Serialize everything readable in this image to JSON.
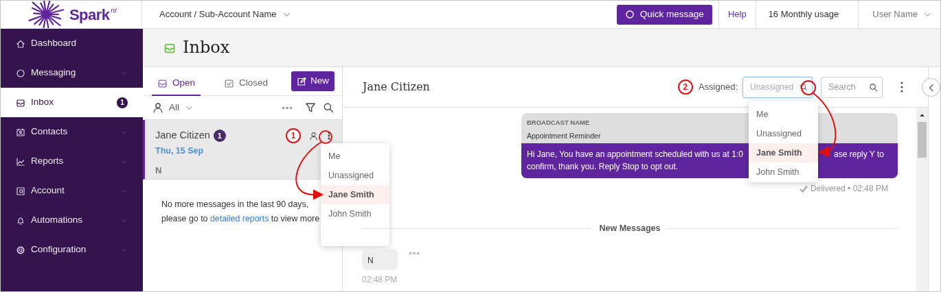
{
  "header": {
    "logo": "Spark$^{nz}$",
    "account": "Account / Sub-Account Name",
    "quick_message": "Quick message",
    "help": "Help",
    "usage": "16 Monthly usage",
    "user": "User Name"
  },
  "sidebar": {
    "items": [
      {
        "label": "Dashboard",
        "has_submenu": false,
        "selected": false
      },
      {
        "label": "Messaging",
        "has_submenu": true,
        "selected": false
      },
      {
        "label": "Inbox",
        "has_submenu": false,
        "selected": true,
        "badge": "1"
      },
      {
        "label": "Contacts",
        "has_submenu": true,
        "selected": false
      },
      {
        "label": "Reports",
        "has_submenu": true,
        "selected": false
      },
      {
        "label": "Account",
        "has_submenu": true,
        "selected": false
      },
      {
        "label": "Automations",
        "has_submenu": true,
        "selected": false
      },
      {
        "label": "Configuration",
        "has_submenu": true,
        "selected": false
      }
    ]
  },
  "page_title": "Inbox",
  "conversation_list": {
    "tabs": [
      {
        "label": "Open",
        "selected": true
      },
      {
        "label": "Closed",
        "selected": false
      }
    ],
    "new_button": "New",
    "filter": "All",
    "items": [
      {
        "name": "Jane Citizen",
        "badge": "1",
        "date": "Thu, 15 Sep",
        "preview": "N",
        "selected": true,
        "marker": "1"
      }
    ],
    "end_note": {
      "line_1": "No more messages in the last 90 days,",
      "before_link": "please go to",
      "link": "detailed reports",
      "after_link": "to view more"
    },
    "assign_menu": {
      "options": [
        {
          "label": "Me",
          "selected": false
        },
        {
          "label": "Unassigned",
          "selected": false
        },
        {
          "label": "Jane Smith",
          "selected": true
        },
        {
          "label": "John Smith",
          "selected": false
        }
      ]
    }
  },
  "conversation": {
    "title": "Jane Citizen",
    "marker": "2",
    "assigned": {
      "label": "Assigned:",
      "placeholder": "Unassigned",
      "focused": true,
      "options": [
        {
          "label": "Me",
          "selected": false
        },
        {
          "label": "Unassigned",
          "selected": false
        },
        {
          "label": "Jane Smith",
          "selected": true
        },
        {
          "label": "John Smith",
          "selected": false
        }
      ]
    },
    "search": {
      "placeholder": "Search"
    },
    "messages": [
      {
        "kind": "broadcast",
        "title": "BROADCAST NAME",
        "subtitle": "Appointment Reminder",
        "line_1_start": "Hi Jane, You have an appointment scheduled with us at 1:0",
        "line_1_end": "ase reply Y to",
        "line_2": "confirm, thank you. Reply Stop to opt out.",
        "status": "Delivered • 02:48 PM"
      },
      {
        "kind": "divider",
        "label": "New Messages"
      },
      {
        "kind": "incoming",
        "text": "N",
        "time": "02:48 PM"
      }
    ]
  }
}
